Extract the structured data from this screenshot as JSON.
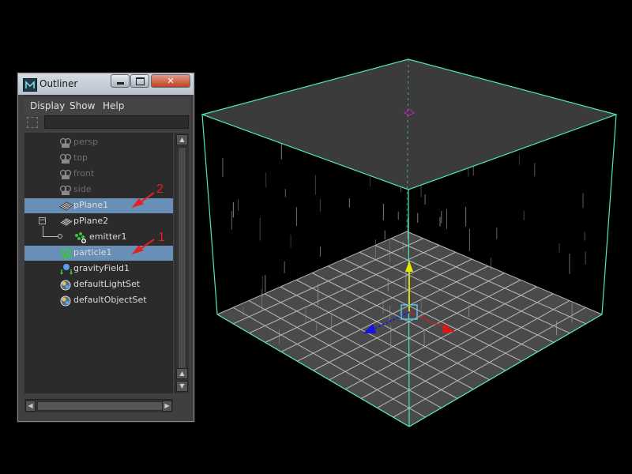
{
  "outliner": {
    "title": "Outliner",
    "close_glyph": "✕",
    "menu": {
      "display": "Display",
      "show": "Show",
      "help": "Help"
    },
    "search_value": "",
    "items": [
      {
        "label": "persp",
        "icon": "camera-icon",
        "dim": true,
        "selected": false
      },
      {
        "label": "top",
        "icon": "camera-icon",
        "dim": true,
        "selected": false
      },
      {
        "label": "front",
        "icon": "camera-icon",
        "dim": true,
        "selected": false
      },
      {
        "label": "side",
        "icon": "camera-icon",
        "dim": true,
        "selected": false
      },
      {
        "label": "pPlane1",
        "icon": "plane-mesh-icon",
        "dim": false,
        "selected": true
      },
      {
        "label": "pPlane2",
        "icon": "plane-mesh-icon",
        "dim": false,
        "selected": false,
        "expanded": true
      },
      {
        "label": "emitter1",
        "icon": "emitter-icon",
        "dim": false,
        "selected": false,
        "child": true
      },
      {
        "label": "particle1",
        "icon": "particle-icon",
        "dim": false,
        "selected": true
      },
      {
        "label": "gravityField1",
        "icon": "gravity-field-icon",
        "dim": false,
        "selected": false
      },
      {
        "label": "defaultLightSet",
        "icon": "set-icon",
        "dim": false,
        "selected": false
      },
      {
        "label": "defaultObjectSet",
        "icon": "set-icon",
        "dim": false,
        "selected": false
      }
    ]
  },
  "annotations": {
    "label_1": "1",
    "label_2": "2",
    "color": "#e81f1f"
  },
  "colors": {
    "selection": "#678fb7",
    "bounding_box": "#4fe8b8",
    "grid_line": "#cfcfcf",
    "plane_fill": "#3b3b3b"
  }
}
